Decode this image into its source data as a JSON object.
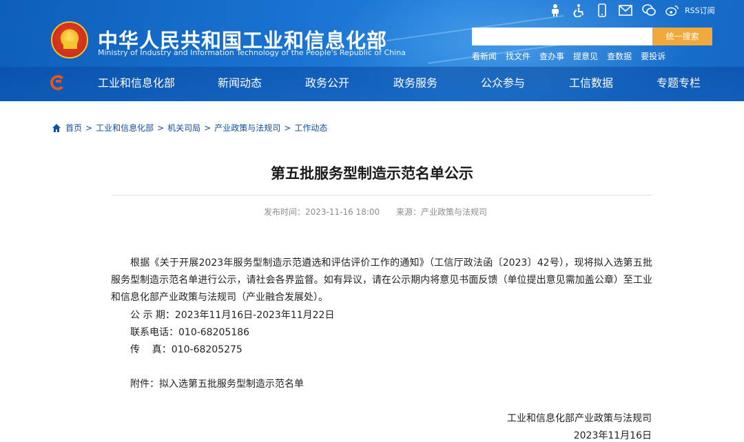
{
  "header": {
    "site_title": "中华人民共和国工业和信息化部",
    "site_subtitle": "Ministry of Industry and Information Technology of the People's Republic of China",
    "top_icons": [
      "robot-icon",
      "accessibility-icon",
      "mobile-icon",
      "mail-icon",
      "wechat-icon",
      "weibo-icon"
    ],
    "rss_label": "RSS订阅",
    "search": {
      "placeholder": "",
      "button_label": "统一搜索"
    },
    "quick_links": [
      "看新闻",
      "找文件",
      "查办事",
      "提意见",
      "查数据",
      "要投诉"
    ],
    "nav_items": [
      "工业和信息化部",
      "新闻动态",
      "政务公开",
      "政务服务",
      "公众参与",
      "工信数据",
      "专题专栏"
    ],
    "colors": {
      "header_blue": "#1a73d1",
      "search_button": "#f2a93b",
      "link_blue": "#0d4ea8"
    }
  },
  "breadcrumb": [
    "首页",
    "工业和信息化部",
    "机关司局",
    "产业政策与法规司",
    "工作动态"
  ],
  "article": {
    "title": "第五批服务型制造示范名单公示",
    "publish_time": "发布时间：2023-11-16 18:00",
    "source": "来源：产业政策与法规司",
    "paragraph": "根据《关于开展2023年服务型制造示范遴选和评估评价工作的通知》（工信厅政法函〔2023〕42号），现将拟入选第五批服务型制造示范名单进行公示，请社会各界监督。如有异议，请在公示期内将意见书面反馈（单位提出意见需加盖公章）至工业和信息化部产业政策与法规司（产业融合发展处）。",
    "period": "公 示 期：2023年11月16日-2023年11月22日",
    "phone": "联系电话：010-68205186",
    "fax": "传    真：010-68205275",
    "attachment": "附件：拟入选第五批服务型制造示范名单",
    "signature_org": "工业和信息化部产业政策与法规司",
    "signature_date": "2023年11月16日"
  }
}
